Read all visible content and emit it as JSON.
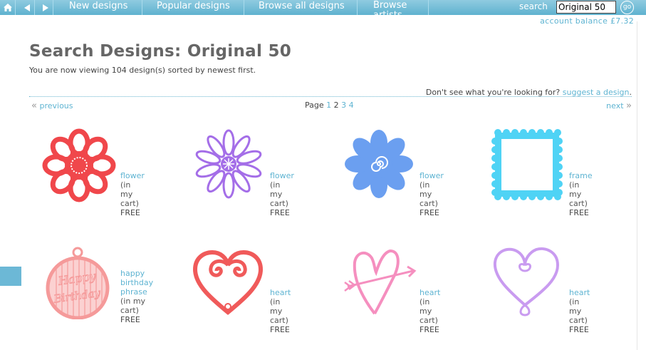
{
  "nav": {
    "links": [
      "New designs",
      "Popular designs",
      "Browse all designs",
      "Browse artists"
    ],
    "search_label": "search",
    "search_value": "Original 50",
    "go_label": "go"
  },
  "account_balance": "account balance £7.32",
  "page": {
    "title": "Search Designs: Original 50",
    "subtitle": "You are now viewing 104 design(s) sorted by newest first."
  },
  "suggest": {
    "text": "Don't see what you're looking for?",
    "link": "suggest a design",
    "tail": "."
  },
  "pagination": {
    "prev": "previous",
    "label": "Page",
    "pages": [
      "1",
      "2",
      "3",
      "4"
    ],
    "current": "2",
    "next": "next"
  },
  "designs": [
    {
      "name": "flower",
      "status": "(in my cart)",
      "price": "FREE",
      "color": "#f0474b",
      "icon": "flower-icon"
    },
    {
      "name": "flower",
      "status": "(in my cart)",
      "price": "FREE",
      "color": "#a46ee8",
      "icon": "daisy-icon"
    },
    {
      "name": "flower",
      "status": "(in my cart)",
      "price": "FREE",
      "color": "#6b9ff0",
      "icon": "swirl-flower-icon"
    },
    {
      "name": "frame",
      "status": "(in my cart)",
      "price": "FREE",
      "color": "#4fd3f5",
      "icon": "scalloped-frame-icon"
    },
    {
      "name": "happy birthday phrase",
      "status": "(in my cart)",
      "price": "FREE",
      "color": "#f59a9a",
      "icon": "birthday-tag-icon"
    },
    {
      "name": "heart",
      "status": "(in my cart)",
      "price": "FREE",
      "color": "#f05a5a",
      "icon": "swirl-heart-icon"
    },
    {
      "name": "heart",
      "status": "(in my cart)",
      "price": "FREE",
      "color": "#f58fbf",
      "icon": "heart-arrow-icon"
    },
    {
      "name": "heart",
      "status": "(in my cart)",
      "price": "FREE",
      "color": "#c99bf0",
      "icon": "loop-heart-icon"
    }
  ]
}
